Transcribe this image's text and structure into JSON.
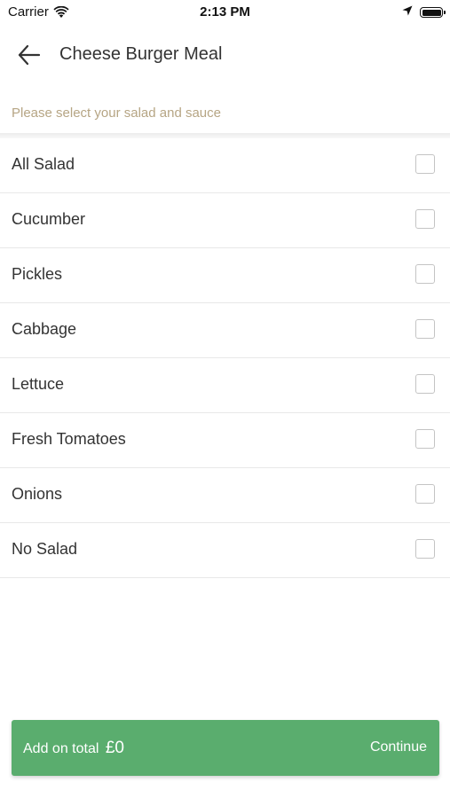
{
  "status_bar": {
    "carrier": "Carrier",
    "time": "2:13 PM"
  },
  "header": {
    "title": "Cheese Burger Meal"
  },
  "subtitle": "Please select your salad and sauce",
  "options": [
    {
      "label": "All Salad",
      "checked": false
    },
    {
      "label": "Cucumber",
      "checked": false
    },
    {
      "label": "Pickles",
      "checked": false
    },
    {
      "label": "Cabbage",
      "checked": false
    },
    {
      "label": "Lettuce",
      "checked": false
    },
    {
      "label": "Fresh Tomatoes",
      "checked": false
    },
    {
      "label": "Onions",
      "checked": false
    },
    {
      "label": "No Salad",
      "checked": false
    }
  ],
  "footer": {
    "addon_label": "Add on total",
    "addon_amount": "£0",
    "continue_label": "Continue"
  },
  "colors": {
    "accent_green": "#5aad6e",
    "subtitle_tan": "#b6a584"
  }
}
